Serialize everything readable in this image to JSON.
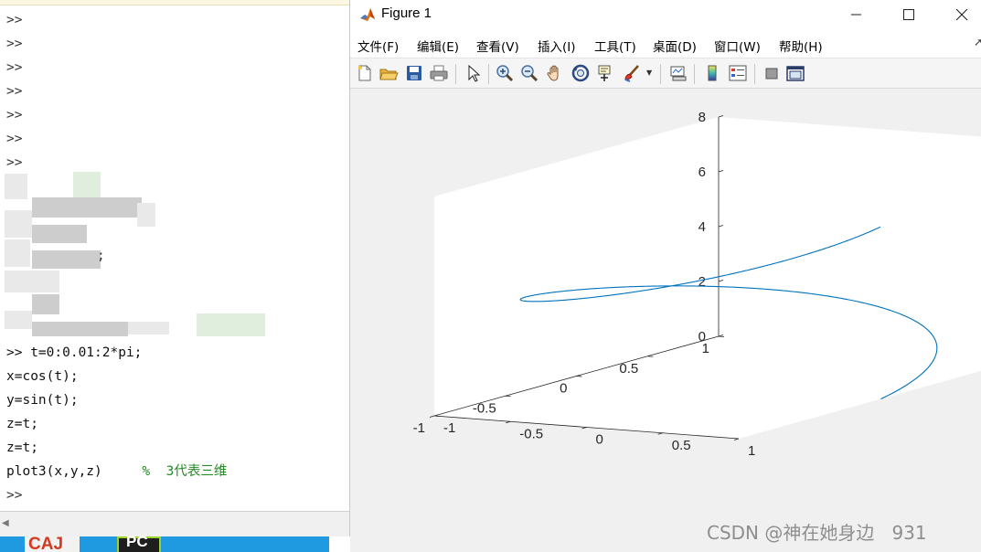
{
  "command_window": {
    "prompts": [
      ">>",
      ">>",
      ">>",
      ">>",
      ">>",
      ">>",
      ">>"
    ],
    "obscured_fragments": [
      ";"
    ],
    "code_lines": [
      {
        "text": ">> t=0:0.01:2*pi;",
        "comment": ""
      },
      {
        "text": "x=cos(t);",
        "comment": ""
      },
      {
        "text": "y=sin(t);",
        "comment": ""
      },
      {
        "text": "z=t;",
        "comment": ""
      },
      {
        "text": "z=t;",
        "comment": ""
      },
      {
        "text": "plot3(x,y,z)     ",
        "comment": "%  3代表三维"
      }
    ],
    "final_prompt": ">>"
  },
  "taskbar": {
    "caj_label": "CAJ",
    "pc_label": "PC"
  },
  "figure": {
    "title": "Figure 1",
    "window_controls": [
      "minimize-icon",
      "maximize-icon",
      "close-icon"
    ],
    "menu": [
      "文件(F)",
      "编辑(E)",
      "查看(V)",
      "插入(I)",
      "工具(T)",
      "桌面(D)",
      "窗口(W)",
      "帮助(H)"
    ],
    "toolbar_icons": [
      "new-figure-icon",
      "open-file-icon",
      "save-icon",
      "print-icon",
      "edit-plot-icon",
      "zoom-in-icon",
      "zoom-out-icon",
      "pan-icon",
      "rotate-3d-icon",
      "data-cursor-icon",
      "brush-icon",
      "link-plot-icon",
      "insert-colorbar-icon",
      "insert-legend-icon",
      "hide-plot-tools-icon",
      "show-plot-tools-icon"
    ]
  },
  "chart_data": {
    "type": "line",
    "projection": "3d",
    "title": "",
    "series": [
      {
        "expr_x": "cos(t)",
        "expr_y": "sin(t)",
        "expr_z": "t",
        "t_range": [
          0,
          6.2832
        ],
        "t_step": 0.01,
        "color": "#0072bd"
      }
    ],
    "xlim": [
      -1,
      1
    ],
    "ylim": [
      -1,
      1
    ],
    "zlim": [
      0,
      8
    ],
    "x_ticks": [
      "-1",
      "-0.5",
      "0",
      "0.5",
      "1"
    ],
    "y_ticks": [
      "-1",
      "-0.5",
      "0",
      "0.5",
      "1"
    ],
    "z_ticks": [
      "0",
      "2",
      "4",
      "6",
      "8"
    ],
    "grid": false
  },
  "watermark": "CSDN @神在她身边   931"
}
